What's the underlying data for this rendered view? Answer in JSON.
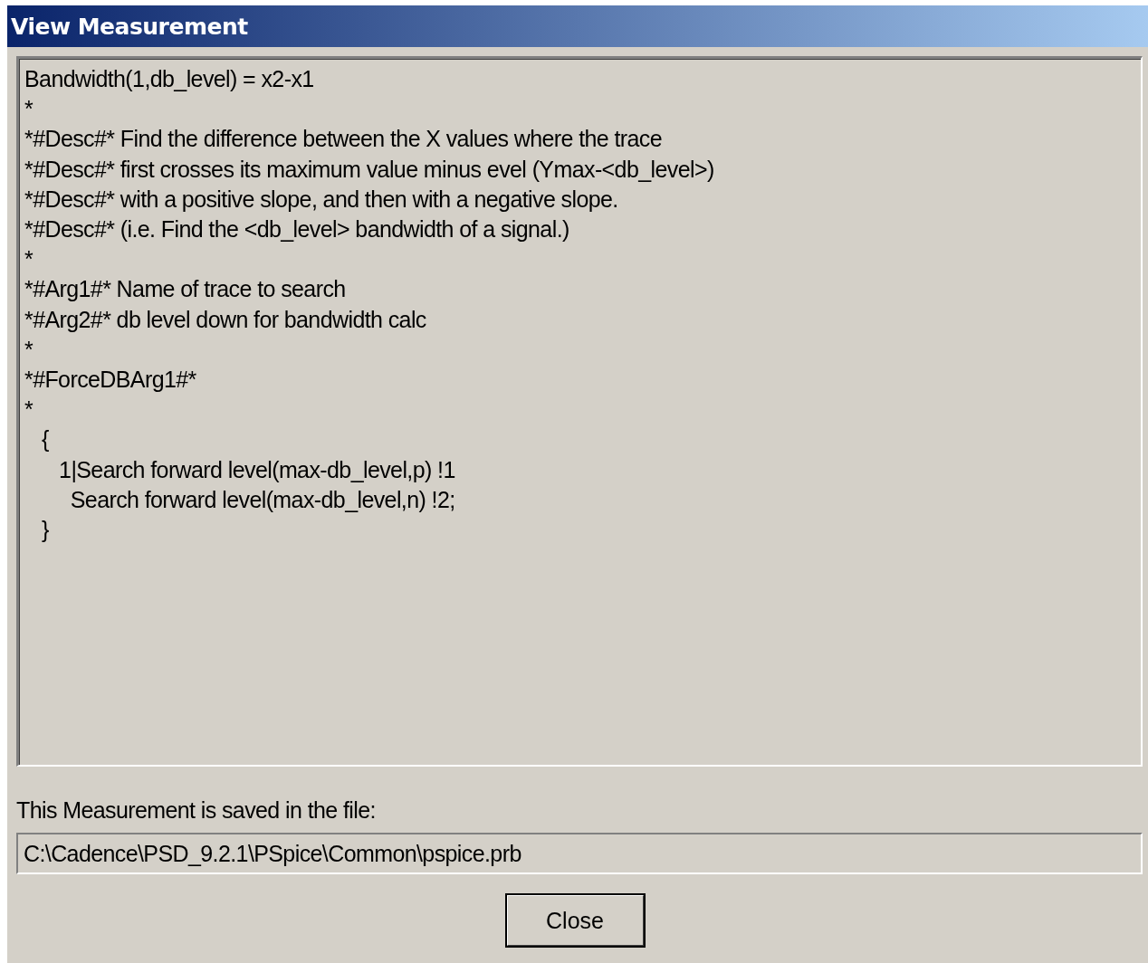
{
  "window": {
    "title": "View Measurement"
  },
  "definition": {
    "lines": [
      "Bandwidth(1,db_level) = x2-x1",
      "*",
      "*#Desc#* Find the difference between the X values where the trace",
      "*#Desc#* first crosses its maximum value minus evel (Ymax-<db_level>)",
      "*#Desc#* with a positive slope, and then with a negative slope.",
      "*#Desc#* (i.e. Find the <db_level> bandwidth of a signal.)",
      "*",
      "*#Arg1#* Name of trace to search",
      "*#Arg2#* db level down for bandwidth calc",
      "*",
      "*#ForceDBArg1#*",
      "*",
      "   {",
      "      1|Search forward level(max-db_level,p) !1",
      "        Search forward level(max-db_level,n) !2;",
      "   }"
    ]
  },
  "file_label": "This Measurement is saved in the file:",
  "file_path": {
    "value": "C:\\Cadence\\PSD_9.2.1\\PSpice\\Common\\pspice.prb"
  },
  "buttons": [
    "Close"
  ]
}
